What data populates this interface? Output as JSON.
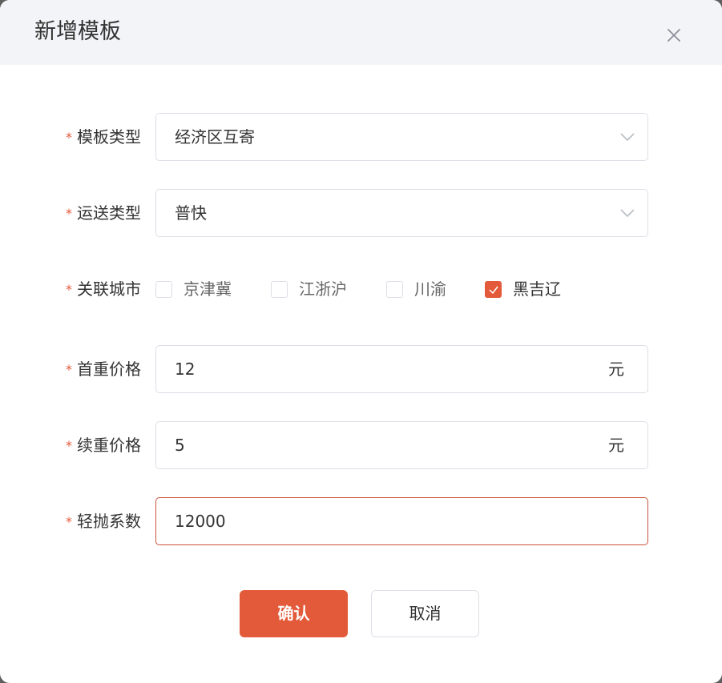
{
  "dialog": {
    "title": "新增模板",
    "close_icon": "close-icon"
  },
  "required_mark": "*",
  "form": {
    "template_type": {
      "label": "模板类型",
      "value": "经济区互寄"
    },
    "shipping_type": {
      "label": "运送类型",
      "value": "普快"
    },
    "related_cities": {
      "label": "关联城市",
      "options": [
        {
          "label": "京津冀",
          "checked": false
        },
        {
          "label": "江浙沪",
          "checked": false
        },
        {
          "label": "川渝",
          "checked": false
        },
        {
          "label": "黑吉辽",
          "checked": true
        }
      ]
    },
    "first_weight_price": {
      "label": "首重价格",
      "value": "12",
      "unit": "元"
    },
    "additional_weight_price": {
      "label": "续重价格",
      "value": "5",
      "unit": "元"
    },
    "volumetric_factor": {
      "label": "轻抛系数",
      "value": "12000"
    }
  },
  "buttons": {
    "confirm": "确认",
    "cancel": "取消"
  },
  "colors": {
    "accent": "#e35a3a",
    "header_bg": "#f3f4f7",
    "border": "#dcdfe6"
  }
}
